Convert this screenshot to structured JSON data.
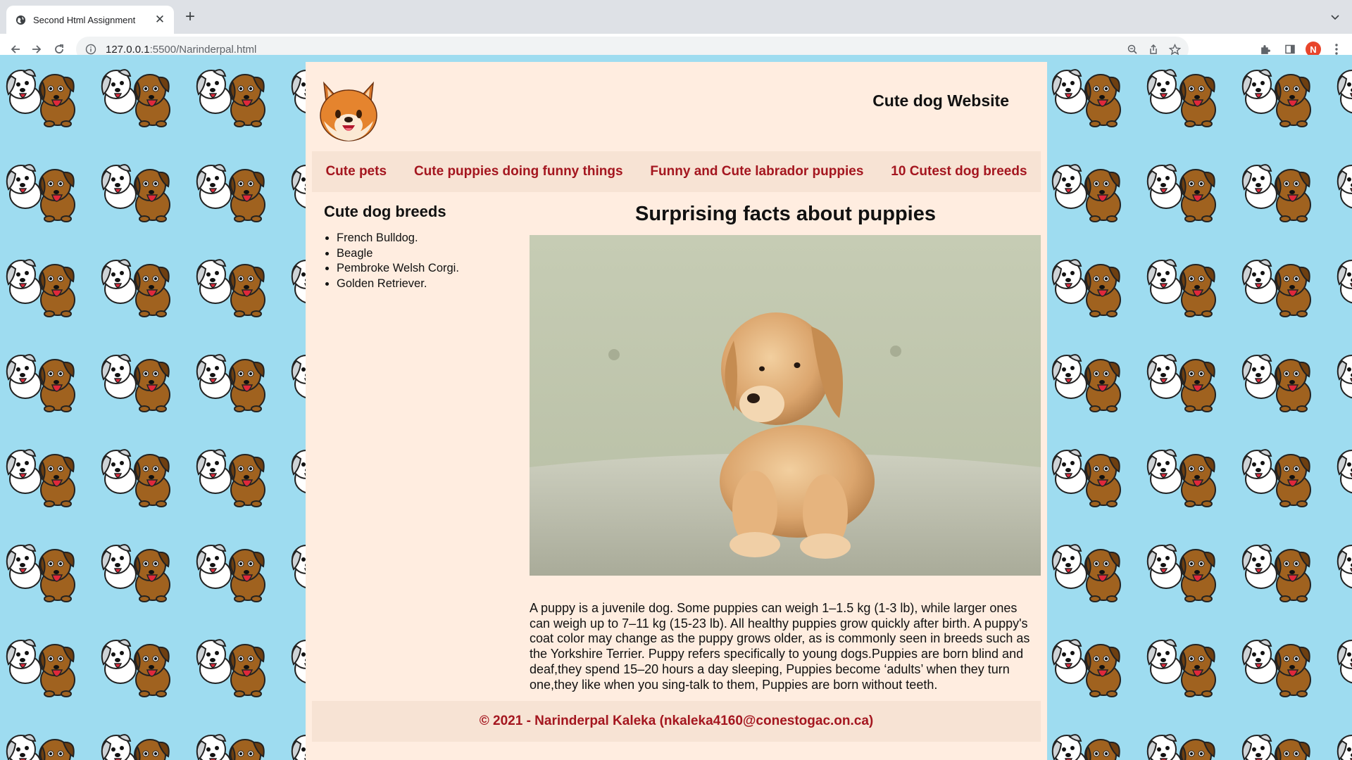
{
  "browser": {
    "tab_title": "Second Html Assignment",
    "url_host": "127.0.0.1",
    "url_path": ":5500/Narinderpal.html",
    "profile_initial": "N"
  },
  "site": {
    "title": "Cute dog Website",
    "nav": [
      "Cute pets",
      "Cute puppies doing funny things",
      "Funny and Cute labrador puppies",
      "10 Cutest dog breeds"
    ],
    "sidebar_heading": "Cute dog breeds",
    "breeds": [
      "French Bulldog.",
      "Beagle",
      "Pembroke Welsh Corgi.",
      "Golden Retriever."
    ],
    "main_heading": "Surprising facts about puppies",
    "paragraph": "A puppy is a juvenile dog. Some puppies can weigh 1–1.5 kg (1-3 lb), while larger ones can weigh up to 7–11 kg (15-23 lb). All healthy puppies grow quickly after birth. A puppy's coat color may change as the puppy grows older, as is commonly seen in breeds such as the Yorkshire Terrier. Puppy refers specifically to young dogs.Puppies are born blind and deaf,they spend 15–20 hours a day sleeping, Puppies become ‘adults’ when they turn one,they like when you sing-talk to them, Puppies are born without teeth.",
    "footer": "© 2021 - Narinderpal Kaleka (nkaleka4160@conestogac.on.ca)"
  },
  "colors": {
    "page_bg": "#ffede0",
    "bar_bg": "#f7e3d4",
    "link": "#a4161f",
    "pattern_bg": "#9edcf0"
  },
  "icons": [
    "globe-icon",
    "close-icon",
    "plus-icon",
    "back-icon",
    "forward-icon",
    "reload-icon",
    "info-icon",
    "zoom-icon",
    "share-icon",
    "star-icon",
    "extensions-icon",
    "side-panel-icon",
    "menu-icon"
  ]
}
